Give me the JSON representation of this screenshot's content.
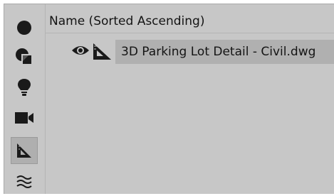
{
  "toolbar": {
    "items": [
      {
        "icon": "circle-icon",
        "active": false
      },
      {
        "icon": "layers-icon",
        "active": false
      },
      {
        "icon": "lightbulb-icon",
        "active": false
      },
      {
        "icon": "video-camera-icon",
        "active": false
      },
      {
        "icon": "set-square-icon",
        "active": true
      },
      {
        "icon": "waves-icon",
        "active": false
      }
    ]
  },
  "list": {
    "column_header": "Name (Sorted Ascending)",
    "rows": [
      {
        "label": "3D Parking Lot Detail - Civil.dwg",
        "visibility_icon": "eye-icon",
        "type_icon": "drawing-icon",
        "selected": true
      }
    ]
  },
  "colors": {
    "panel_background": "#c7c7c7",
    "selected_row": "#b0b0b0",
    "icon": "#1a1a1a"
  }
}
